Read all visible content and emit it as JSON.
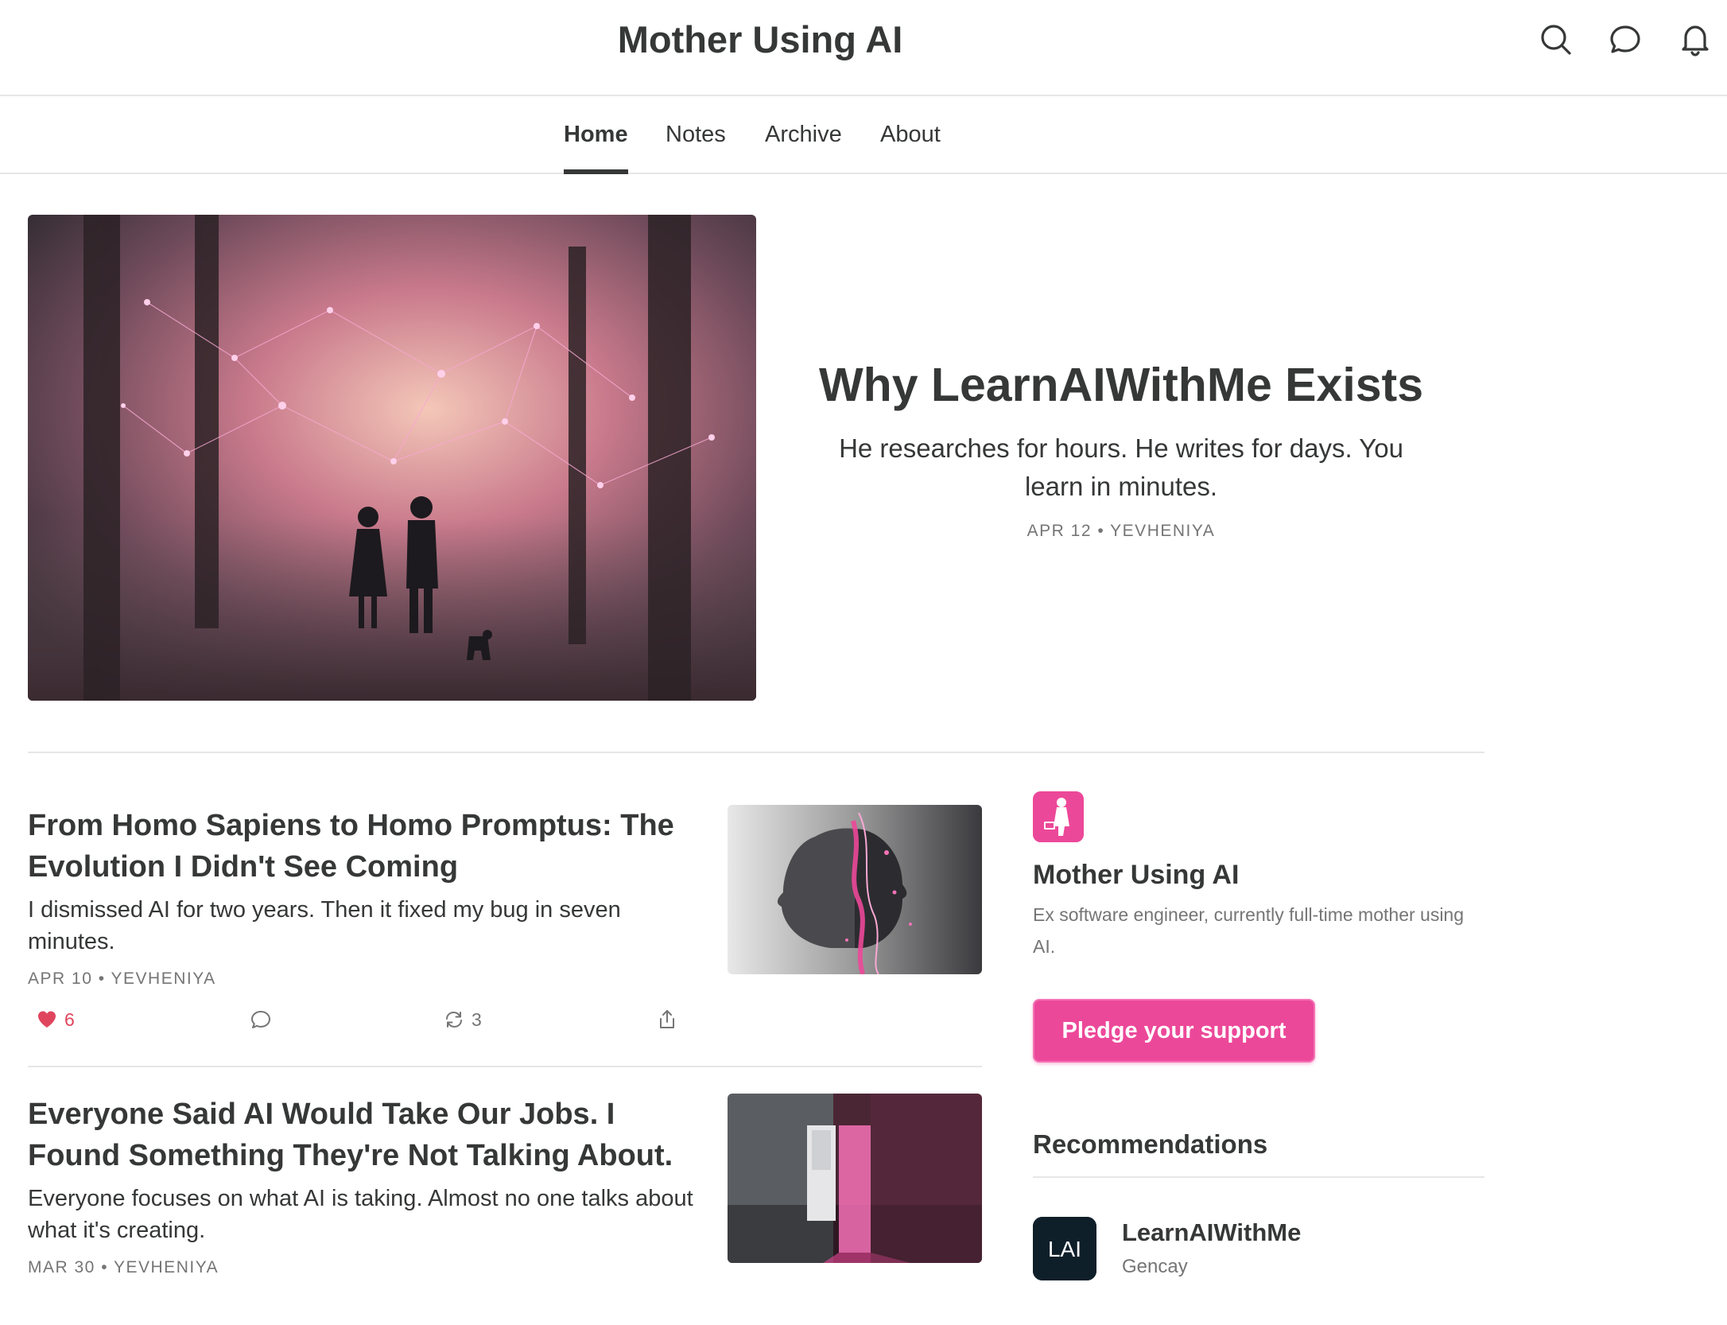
{
  "header": {
    "site_title": "Mother Using AI",
    "icons": [
      "search-icon",
      "chat-icon",
      "bell-icon"
    ]
  },
  "nav": {
    "tabs": [
      {
        "label": "Home",
        "active": true
      },
      {
        "label": "Notes",
        "active": false
      },
      {
        "label": "Archive",
        "active": false
      },
      {
        "label": "About",
        "active": false
      }
    ]
  },
  "featured": {
    "title": "Why LearnAIWithMe Exists",
    "subtitle": "He researches for hours. He writes for days. You learn in minutes.",
    "meta": "APR 12 • YEVHENIYA"
  },
  "posts": [
    {
      "title": "From Homo Sapiens to Homo Promptus: The Evolution I Didn't See Coming",
      "subtitle": "I dismissed AI for two years. Then it fixed my bug in seven minutes.",
      "meta": "APR 10 • YEVHENIYA",
      "likes": "6",
      "restacks": "3"
    },
    {
      "title": "Everyone Said AI Would Take Our Jobs. I Found Something They're Not Talking About.",
      "subtitle": "Everyone focuses on what AI is taking. Almost no one talks about what it's creating.",
      "meta": "MAR 30 • YEVHENIYA"
    }
  ],
  "sidebar": {
    "pub_name": "Mother Using AI",
    "pub_description": "Ex software engineer, currently full-time mother using AI.",
    "pledge_label": "Pledge your support",
    "recommendations_heading": "Recommendations",
    "recommendations": [
      {
        "name": "LearnAIWithMe",
        "author": "Gencay",
        "logo_text": "LAI"
      }
    ]
  },
  "colors": {
    "accent": "#ec4899",
    "like": "#e0455e",
    "text": "#363737",
    "muted": "#757575"
  }
}
